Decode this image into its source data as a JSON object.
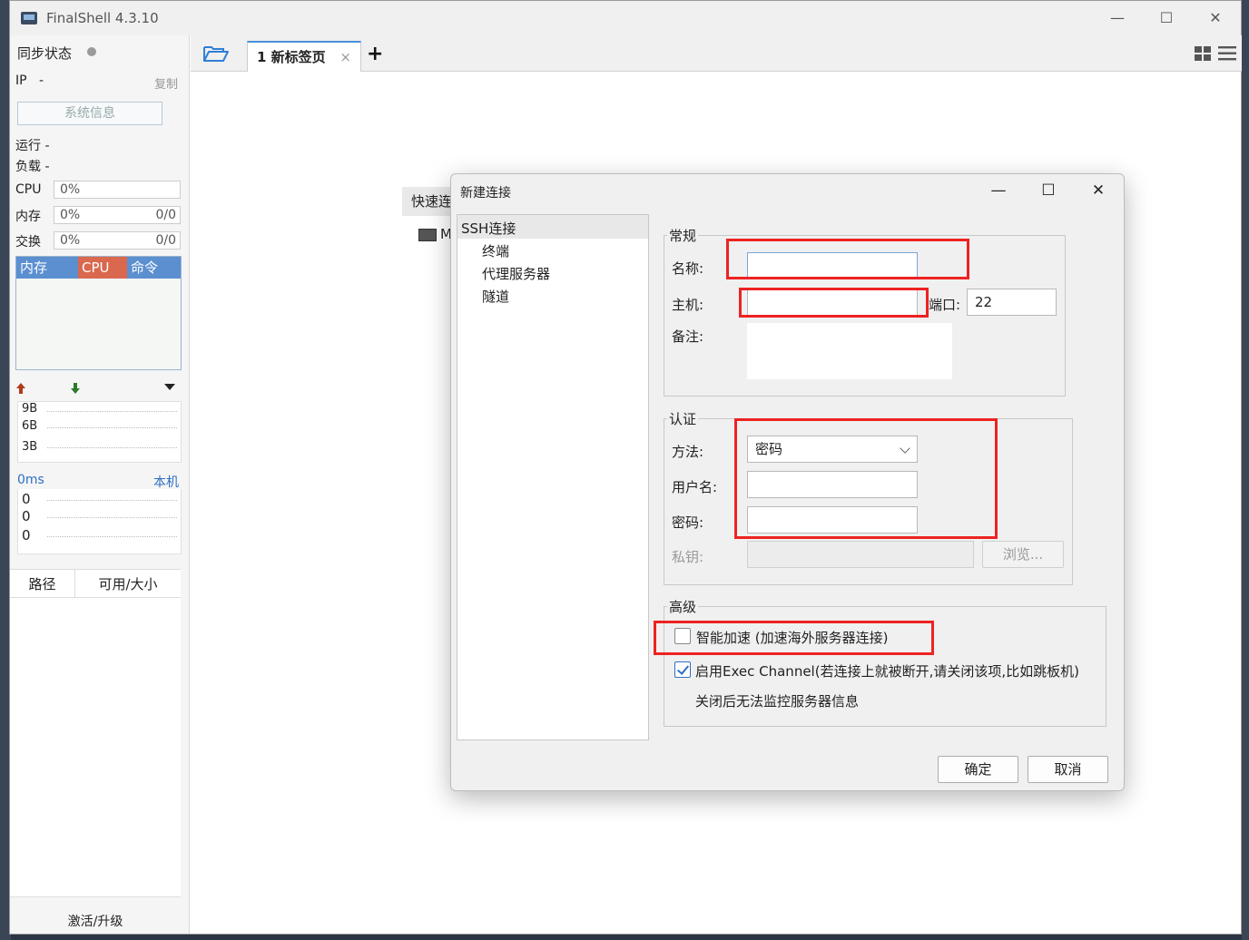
{
  "window": {
    "title": "FinalShell 4.3.10",
    "min": "—",
    "max": "☐",
    "close": "✕"
  },
  "sidebar": {
    "sync_label": "同步状态",
    "ip_label": "IP",
    "ip_value": "-",
    "copy": "复制",
    "sysinfo_button": "系统信息",
    "run_label": "运行 -",
    "load_label": "负载 -",
    "cpu": {
      "label": "CPU",
      "value": "0%"
    },
    "mem": {
      "label": "内存",
      "value": "0%",
      "right": "0/0"
    },
    "swap": {
      "label": "交换",
      "value": "0%",
      "right": "0/0"
    },
    "proc_headers": [
      "内存",
      "CPU",
      "命令"
    ],
    "net_labels": [
      "9B",
      "6B",
      "3B"
    ],
    "ping": {
      "ms": "0ms",
      "host": "本机",
      "values": [
        "0",
        "0",
        "0"
      ]
    },
    "path_headers": [
      "路径",
      "可用/大小"
    ],
    "activate": "激活/升级"
  },
  "tabs": {
    "items": [
      {
        "label": "1 新标签页",
        "close": "×"
      }
    ],
    "add": "+"
  },
  "background": {
    "quick": "快速连接",
    "term": "M"
  },
  "dialog": {
    "title": "新建连接",
    "min": "—",
    "max": "☐",
    "close": "✕",
    "tree": [
      "SSH连接",
      "终端",
      "代理服务器",
      "隧道"
    ],
    "general": {
      "legend": "常规",
      "name_label": "名称:",
      "name_value": "",
      "host_label": "主机:",
      "host_value": "",
      "port_label": "端口:",
      "port_value": "22",
      "note_label": "备注:"
    },
    "auth": {
      "legend": "认证",
      "method_label": "方法:",
      "method_value": "密码",
      "user_label": "用户名:",
      "pass_label": "密码:",
      "key_label": "私钥:",
      "browse": "浏览..."
    },
    "advanced": {
      "legend": "高级",
      "smart_accel": "智能加速 (加速海外服务器连接)",
      "smart_accel_checked": false,
      "exec_channel": "启用Exec Channel(若连接上就被断开,请关闭该项,比如跳板机)",
      "exec_channel_checked": true,
      "exec_note": "关闭后无法监控服务器信息"
    },
    "ok": "确定",
    "cancel": "取消"
  },
  "colors": {
    "proc_mem": "#5b8fd0",
    "proc_cpu": "#d9684e",
    "proc_cmd": "#5b8fd0",
    "highlight": "#e22222",
    "accent": "#2f6fc4"
  }
}
